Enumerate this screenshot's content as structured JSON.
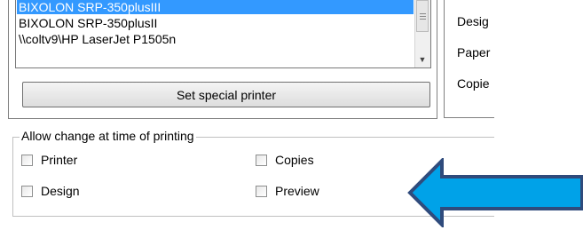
{
  "printer_list": {
    "items": [
      {
        "label": "BIXOLON SRP-350plusIII",
        "selected": true
      },
      {
        "label": "BIXOLON SRP-350plusII",
        "selected": false
      },
      {
        "label": "\\\\coltv9\\HP LaserJet P1505n",
        "selected": false
      }
    ]
  },
  "buttons": {
    "set_special_printer": "Set special printer"
  },
  "info_panel": {
    "design_label": "Desig",
    "paper_label": "Paper",
    "copies_label": "Copie"
  },
  "allow_change": {
    "legend": "Allow change at time of printing",
    "options": [
      {
        "label": "Printer",
        "checked": false
      },
      {
        "label": "Copies",
        "checked": false
      },
      {
        "label": "Design",
        "checked": false
      },
      {
        "label": "Preview",
        "checked": false
      }
    ]
  },
  "colors": {
    "selection": "#3399ff",
    "arrow_fill": "#00a2e8",
    "arrow_stroke": "#2f4b7c"
  }
}
